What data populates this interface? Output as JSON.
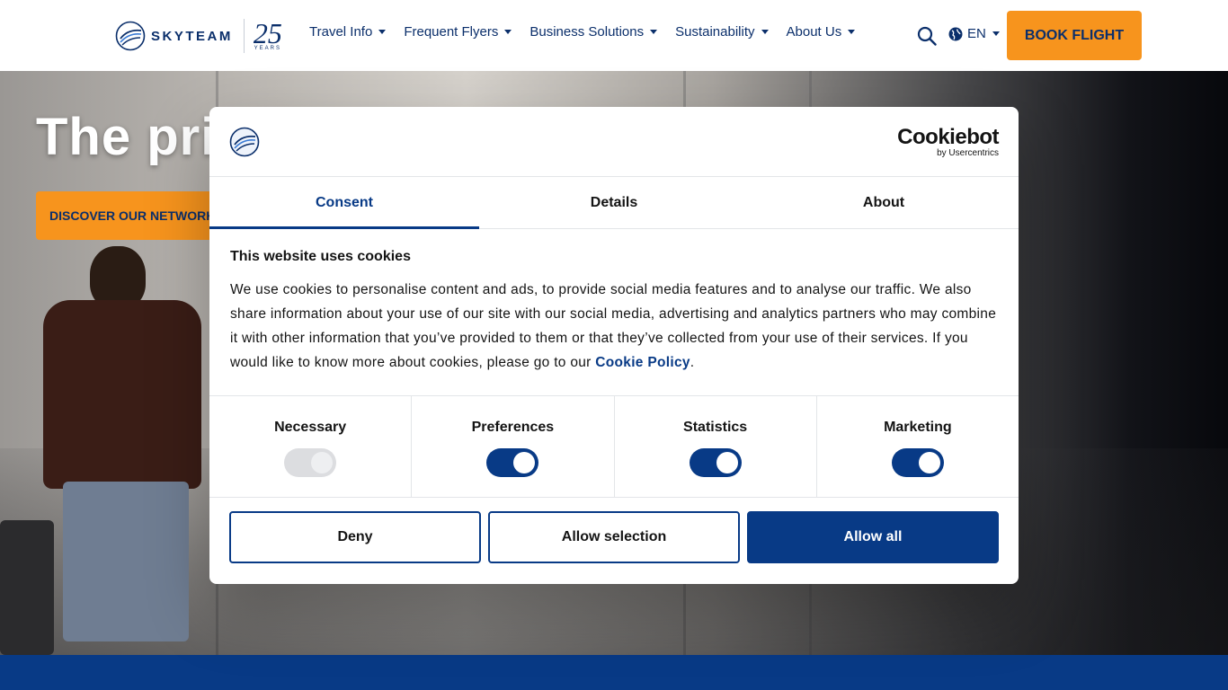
{
  "header": {
    "logo_text": "SKYTEAM",
    "anniversary_number": "25",
    "anniversary_label": "YEARS",
    "nav": [
      {
        "label": "Travel Info"
      },
      {
        "label": "Frequent Flyers"
      },
      {
        "label": "Business Solutions"
      },
      {
        "label": "Sustainability"
      },
      {
        "label": "About Us"
      }
    ],
    "language": "EN",
    "book_button": "BOOK FLIGHT",
    "icons": [
      "search-icon",
      "globe-icon"
    ]
  },
  "hero": {
    "title": "The pric",
    "cta": "DISCOVER OUR NETWORK"
  },
  "cookie_dialog": {
    "brand_name": "Cookiebot",
    "brand_sub": "by Usercentrics",
    "tabs": [
      {
        "label": "Consent",
        "active": true
      },
      {
        "label": "Details",
        "active": false
      },
      {
        "label": "About",
        "active": false
      }
    ],
    "heading": "This website uses cookies",
    "body": "We use cookies to personalise content and ads, to provide social media features and to analyse our traffic. We also share information about your use of our site with our social media, advertising and analytics partners who may combine it with other information that you’ve provided to them or that they’ve collected from your use of their services. If you would like to know more about cookies, please go to our ",
    "policy_link": "Cookie Policy",
    "body_end": ".",
    "toggles": [
      {
        "label": "Necessary",
        "on": true,
        "disabled": true
      },
      {
        "label": "Preferences",
        "on": true,
        "disabled": false
      },
      {
        "label": "Statistics",
        "on": true,
        "disabled": false
      },
      {
        "label": "Marketing",
        "on": true,
        "disabled": false
      }
    ],
    "buttons": {
      "deny": "Deny",
      "allow_selection": "Allow selection",
      "allow_all": "Allow all"
    }
  },
  "colors": {
    "brand_navy": "#083a86",
    "accent_orange": "#f7941d"
  }
}
